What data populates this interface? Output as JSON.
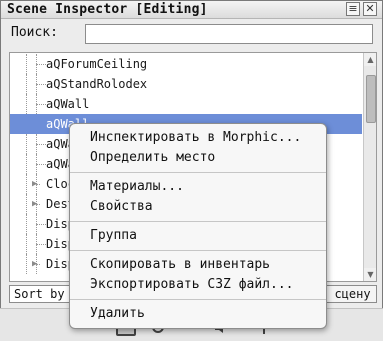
{
  "window": {
    "title": "Scene Inspector [Editing]",
    "menu_glyph": "≡",
    "close_glyph": "✕"
  },
  "search": {
    "label": "Поиск:",
    "value": ""
  },
  "tree": {
    "rows": [
      {
        "label": "aQForumCeiling",
        "expandable": false,
        "selected": false
      },
      {
        "label": "aQStandRolodex",
        "expandable": false,
        "selected": false
      },
      {
        "label": "aQWall",
        "expandable": false,
        "selected": false
      },
      {
        "label": "aQWall",
        "expandable": false,
        "selected": true
      },
      {
        "label": "aQWa",
        "expandable": false,
        "selected": false
      },
      {
        "label": "aQWa",
        "expandable": false,
        "selected": false
      },
      {
        "label": "Cloc",
        "expandable": true,
        "selected": false
      },
      {
        "label": "Dest",
        "expandable": true,
        "selected": false
      },
      {
        "label": "Disp",
        "expandable": false,
        "selected": false
      },
      {
        "label": "Disp",
        "expandable": false,
        "selected": false
      },
      {
        "label": "Disp",
        "expandable": true,
        "selected": false
      }
    ]
  },
  "bottom": {
    "sort_label": "Sort by",
    "right_button_label": "о сцену"
  },
  "context_menu": {
    "groups": [
      [
        "Инспектировать в Morphic...",
        "Определить место"
      ],
      [
        "Материалы...",
        "Свойства"
      ],
      [
        "Группа"
      ],
      [
        "Скопировать в инвентарь",
        "Экспортировать C3Z файл..."
      ],
      [
        "Удалить"
      ]
    ]
  }
}
